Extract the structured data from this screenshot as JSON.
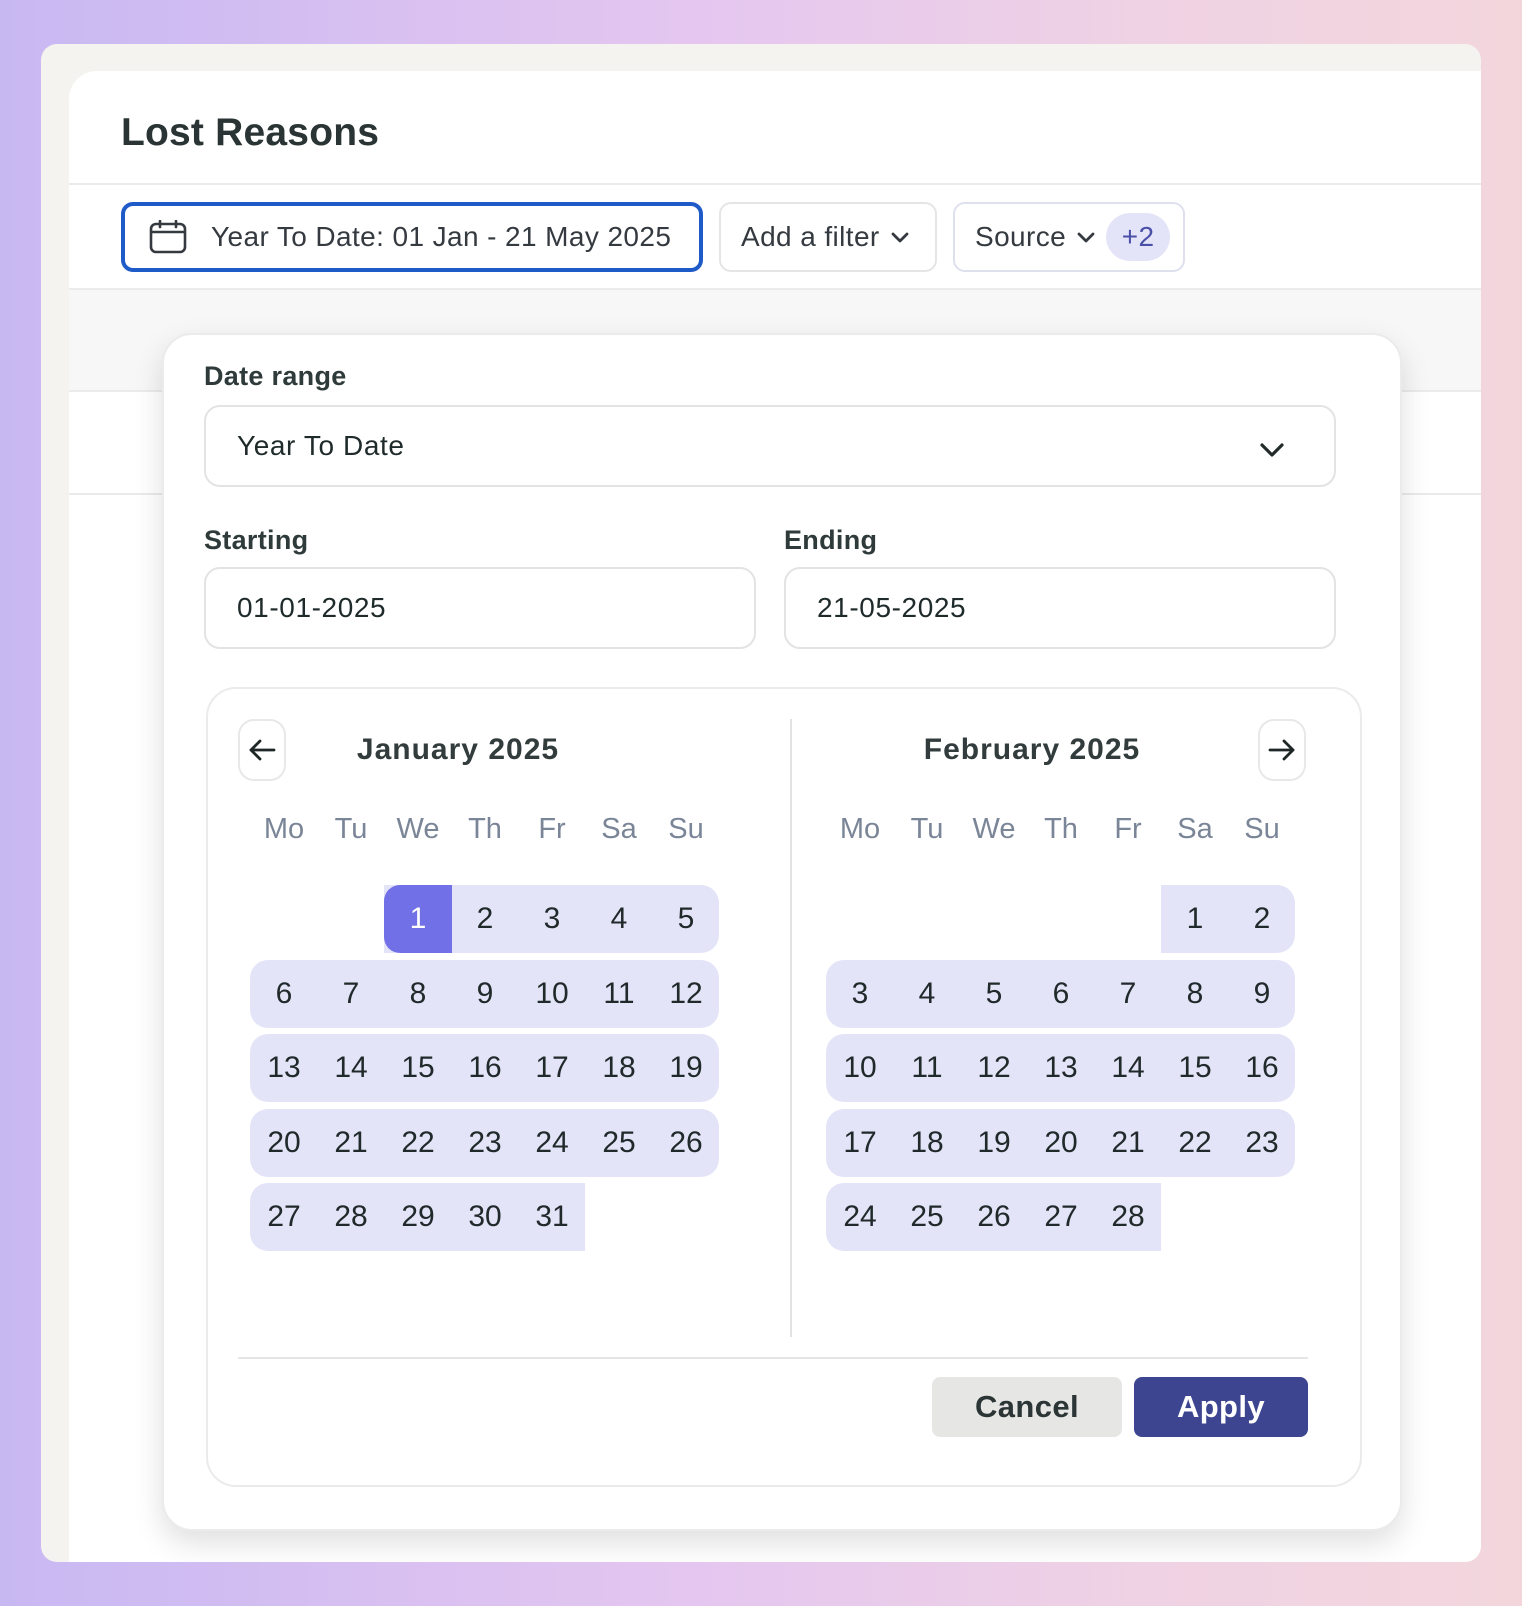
{
  "page": {
    "title": "Lost Reasons"
  },
  "filters": {
    "date_chip": "Year To Date: 01 Jan - 21 May 2025",
    "add_filter": "Add a filter",
    "source": "Source",
    "source_badge": "+2"
  },
  "popover": {
    "date_range_label": "Date range",
    "date_range_value": "Year To Date",
    "starting_label": "Starting",
    "starting_value": "01-01-2025",
    "ending_label": "Ending",
    "ending_value": "21-05-2025",
    "cancel": "Cancel",
    "apply": "Apply"
  },
  "calendar": {
    "weekdays": [
      "Mo",
      "Tu",
      "We",
      "Th",
      "Fr",
      "Sa",
      "Su"
    ],
    "months": [
      {
        "name": "January",
        "year": "2025",
        "first_weekday": 2,
        "days": 31,
        "selected": 1
      },
      {
        "name": "February",
        "year": "2025",
        "first_weekday": 5,
        "days": 28
      }
    ]
  },
  "colors": {
    "accent": "#7270e6",
    "range": "#e4e4f9",
    "apply": "#3d4590",
    "focus_border": "#1f5bc8"
  },
  "icons": {
    "date_chip": "calendar-icon",
    "prev": "arrow-left-icon",
    "next": "arrow-right-icon",
    "dropdown": "chevron-down-icon"
  }
}
